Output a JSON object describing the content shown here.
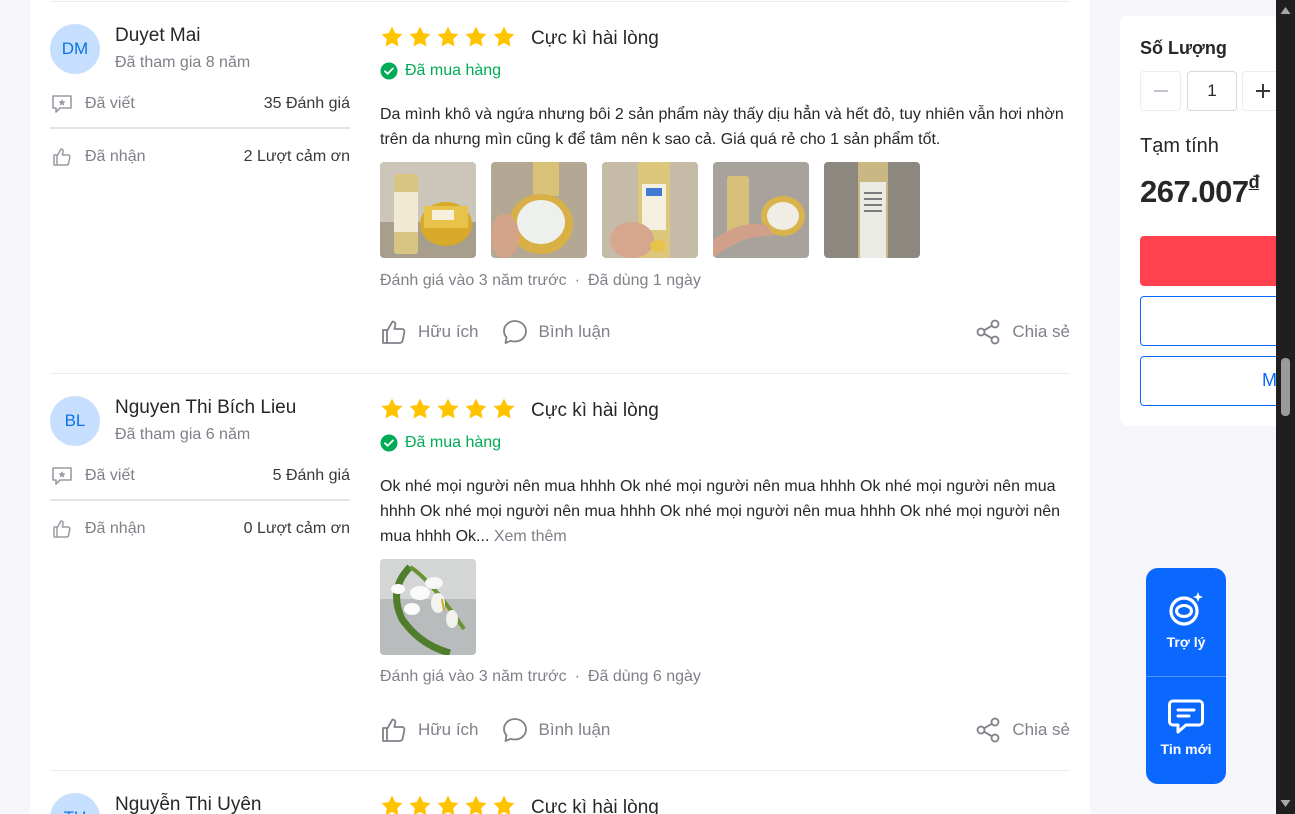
{
  "reviews": [
    {
      "initials": "DM",
      "name": "Duyet Mai",
      "joined": "Đã tham gia 8 năm",
      "written_label": "Đã viết",
      "written_value": "35 Đánh giá",
      "received_label": "Đã nhận",
      "received_value": "2 Lượt cảm ơn",
      "stars": 5,
      "rating_title": "Cực kì hài lòng",
      "purchased": "Đã mua hàng",
      "text": "Da mình khô và ngứa nhưng bôi 2 sản phẩm này thấy dịu hẳn và hết đỏ, tuy nhiên vẫn hơi nhờn trên da nhưng mìn cũng k để tâm nên k sao cả. Giá quá rẻ cho 1 sản phẩm tốt.",
      "review_date": "Đánh giá vào 3 năm trước",
      "usage": "Đã dùng 1 ngày",
      "helpful": "Hữu ích",
      "comment": "Bình luận",
      "share": "Chia sẻ"
    },
    {
      "initials": "BL",
      "name": "Nguyen Thi Bích Lieu",
      "joined": "Đã tham gia 6 năm",
      "written_label": "Đã viết",
      "written_value": "5 Đánh giá",
      "received_label": "Đã nhận",
      "received_value": "0 Lượt cảm ơn",
      "stars": 5,
      "rating_title": "Cực kì hài lòng",
      "purchased": "Đã mua hàng",
      "text": " Ok nhé mọi người nên mua hhhh Ok nhé mọi người nên mua hhhh Ok nhé mọi người nên mua hhhh Ok nhé mọi người nên mua hhhh Ok nhé mọi người nên mua hhhh Ok nhé mọi người nên mua hhhh Ok...",
      "more": " Xem thêm",
      "review_date": "Đánh giá vào 3 năm trước",
      "usage": "Đã dùng 6 ngày",
      "helpful": "Hữu ích",
      "comment": "Bình luận",
      "share": "Chia sẻ"
    },
    {
      "initials": "TU",
      "name": "Nguyễn Thi Uyên",
      "stars": 5,
      "rating_title": "Cực kì hài lòng"
    }
  ],
  "sidebar": {
    "quantity_label": "Số Lượng",
    "quantity_value": "1",
    "subtotal_label": "Tạm tính",
    "subtotal_price": "267.007",
    "currency": "đ",
    "second_button_text": "M"
  },
  "float_widget": {
    "assistant_label": "Trợ lý",
    "messages_label": "Tin mới"
  },
  "colors": {
    "accent": "#0a68ff",
    "buy": "#ff424e",
    "star": "#ffc400",
    "success": "#00ab56"
  }
}
